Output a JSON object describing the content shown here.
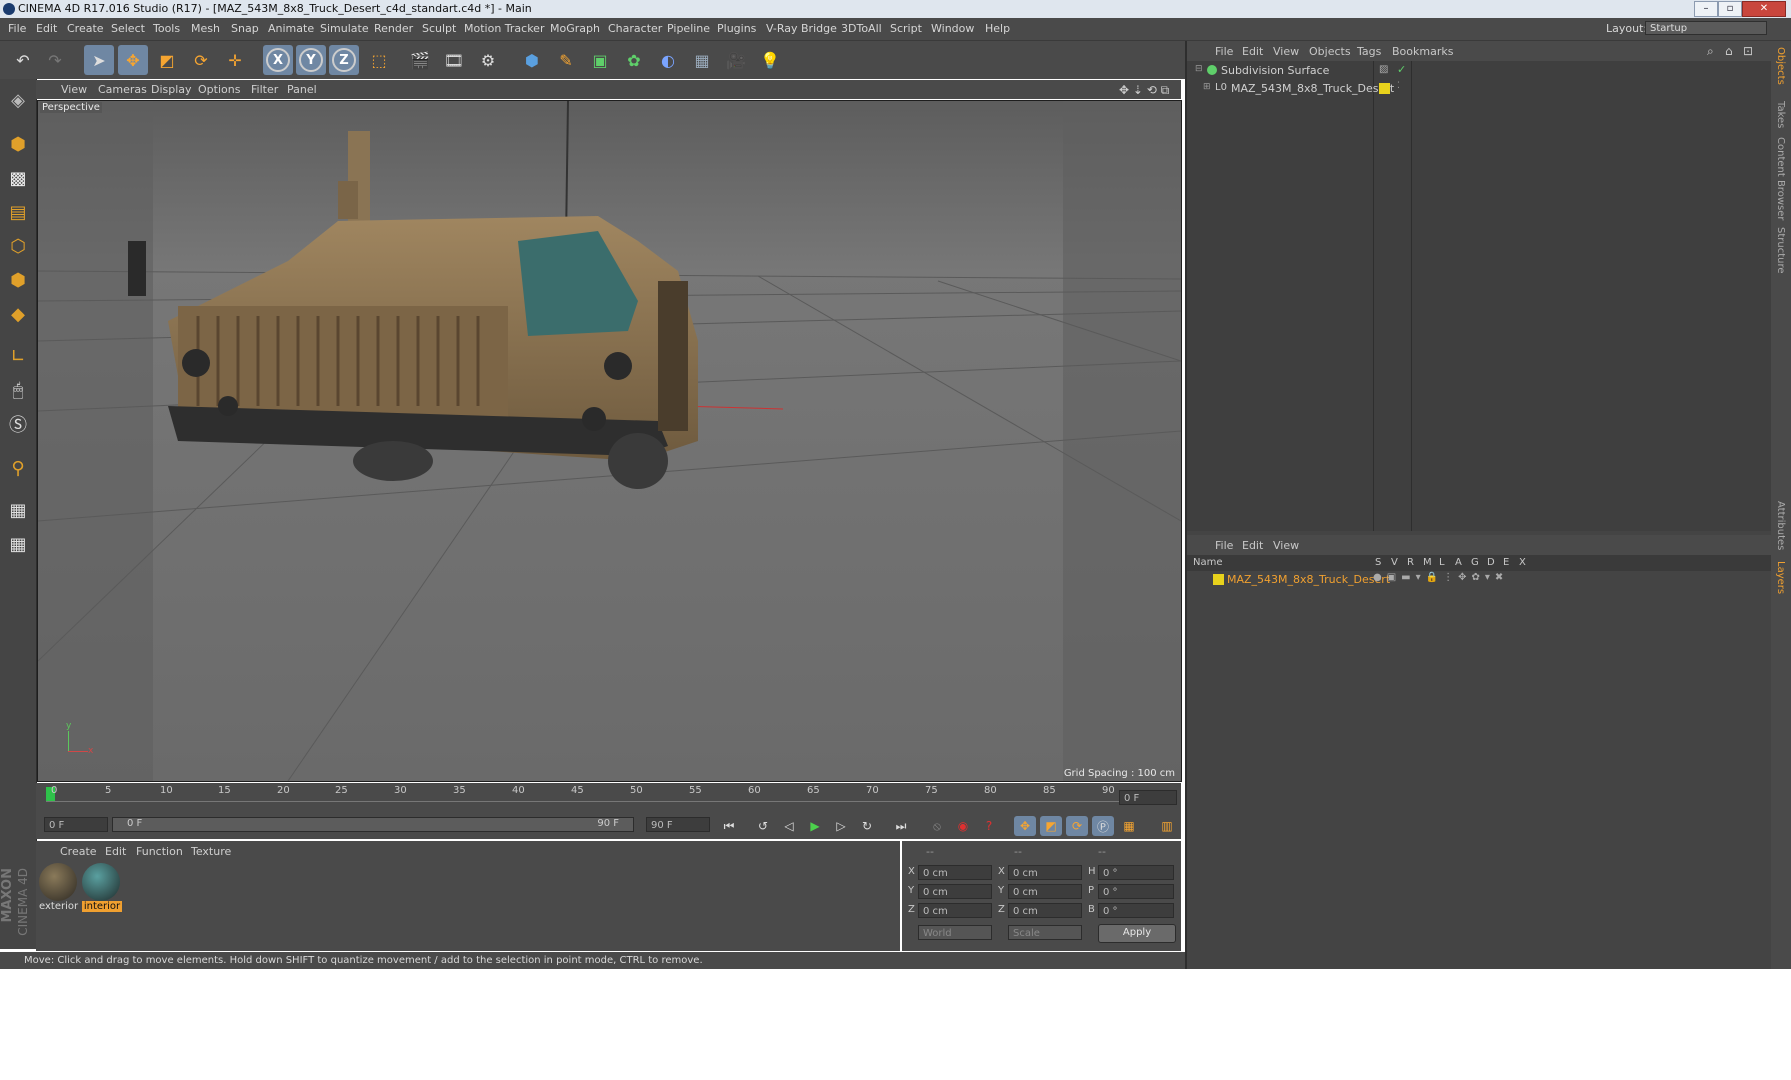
{
  "window": {
    "title": "CINEMA 4D R17.016 Studio (R17) - [MAZ_543M_8x8_Truck_Desert_c4d_standart.c4d *] - Main",
    "buttons": [
      "–",
      "▫",
      "✕"
    ]
  },
  "menubar": {
    "items": [
      "File",
      "Edit",
      "Create",
      "Select",
      "Tools",
      "Mesh",
      "Snap",
      "Animate",
      "Simulate",
      "Render",
      "Sculpt",
      "Motion Tracker",
      "MoGraph",
      "Character",
      "Pipeline",
      "Plugins",
      "V-Ray Bridge",
      "3DToAll",
      "Script",
      "Window",
      "Help"
    ],
    "layout_label": "Layout:",
    "layout_value": "Startup"
  },
  "toolbar": {
    "axis_x": "X",
    "axis_y": "Y",
    "axis_z": "Z"
  },
  "viewport": {
    "menu": [
      "View",
      "Cameras",
      "Display",
      "Options",
      "Filter",
      "Panel"
    ],
    "label": "Perspective",
    "grid_spacing": "Grid Spacing : 100 cm",
    "gizmo_y": "y",
    "gizmo_x": "x"
  },
  "timeline": {
    "ticks": [
      "0",
      "5",
      "10",
      "15",
      "20",
      "25",
      "30",
      "35",
      "40",
      "45",
      "50",
      "55",
      "60",
      "65",
      "70",
      "75",
      "80",
      "85",
      "90"
    ],
    "current_frame": "0 F"
  },
  "transport": {
    "start_field": "0 F",
    "range_left": "0 F",
    "range_right": "90 F",
    "end_field": "90 F"
  },
  "material_manager": {
    "menu": [
      "Create",
      "Edit",
      "Function",
      "Texture"
    ],
    "materials": [
      {
        "name": "exterior",
        "selected": false
      },
      {
        "name": "interior",
        "selected": true
      }
    ],
    "brand_top": "MAXON",
    "brand_bottom": "CINEMA 4D"
  },
  "coordinates": {
    "header": [
      "--",
      "--",
      "--"
    ],
    "rows": [
      {
        "pos_label": "X",
        "pos": "0 cm",
        "size_label": "X",
        "size": "0 cm",
        "rot_label": "H",
        "rot": "0 °"
      },
      {
        "pos_label": "Y",
        "pos": "0 cm",
        "size_label": "Y",
        "size": "0 cm",
        "rot_label": "P",
        "rot": "0 °"
      },
      {
        "pos_label": "Z",
        "pos": "0 cm",
        "size_label": "Z",
        "size": "0 cm",
        "rot_label": "B",
        "rot": "0 °"
      }
    ],
    "mode1": "World",
    "mode2": "Scale",
    "apply": "Apply"
  },
  "status": {
    "text": "Move: Click and drag to move elements. Hold down SHIFT to quantize movement / add to the selection in point mode, CTRL to remove."
  },
  "object_manager": {
    "menu": [
      "File",
      "Edit",
      "View",
      "Objects",
      "Tags",
      "Bookmarks"
    ],
    "objects": [
      {
        "name": "Subdivision Surface"
      },
      {
        "name": "MAZ_543M_8x8_Truck_Desert"
      }
    ]
  },
  "layer_manager": {
    "menu": [
      "File",
      "Edit",
      "View"
    ],
    "col_name": "Name",
    "cols": [
      "S",
      "V",
      "R",
      "M",
      "L",
      "A",
      "G",
      "D",
      "E",
      "X"
    ],
    "layers": [
      {
        "name": "MAZ_543M_8x8_Truck_Desert"
      }
    ]
  },
  "right_tabs": [
    "Objects",
    "Takes",
    "Content Browser",
    "Structure"
  ],
  "right_tabs_lower": [
    "Attributes",
    "Layers"
  ],
  "colors": {
    "accent_orange": "#f0a030",
    "layer_yellow": "#e8d21c",
    "active_blue": "#6f87a3"
  }
}
